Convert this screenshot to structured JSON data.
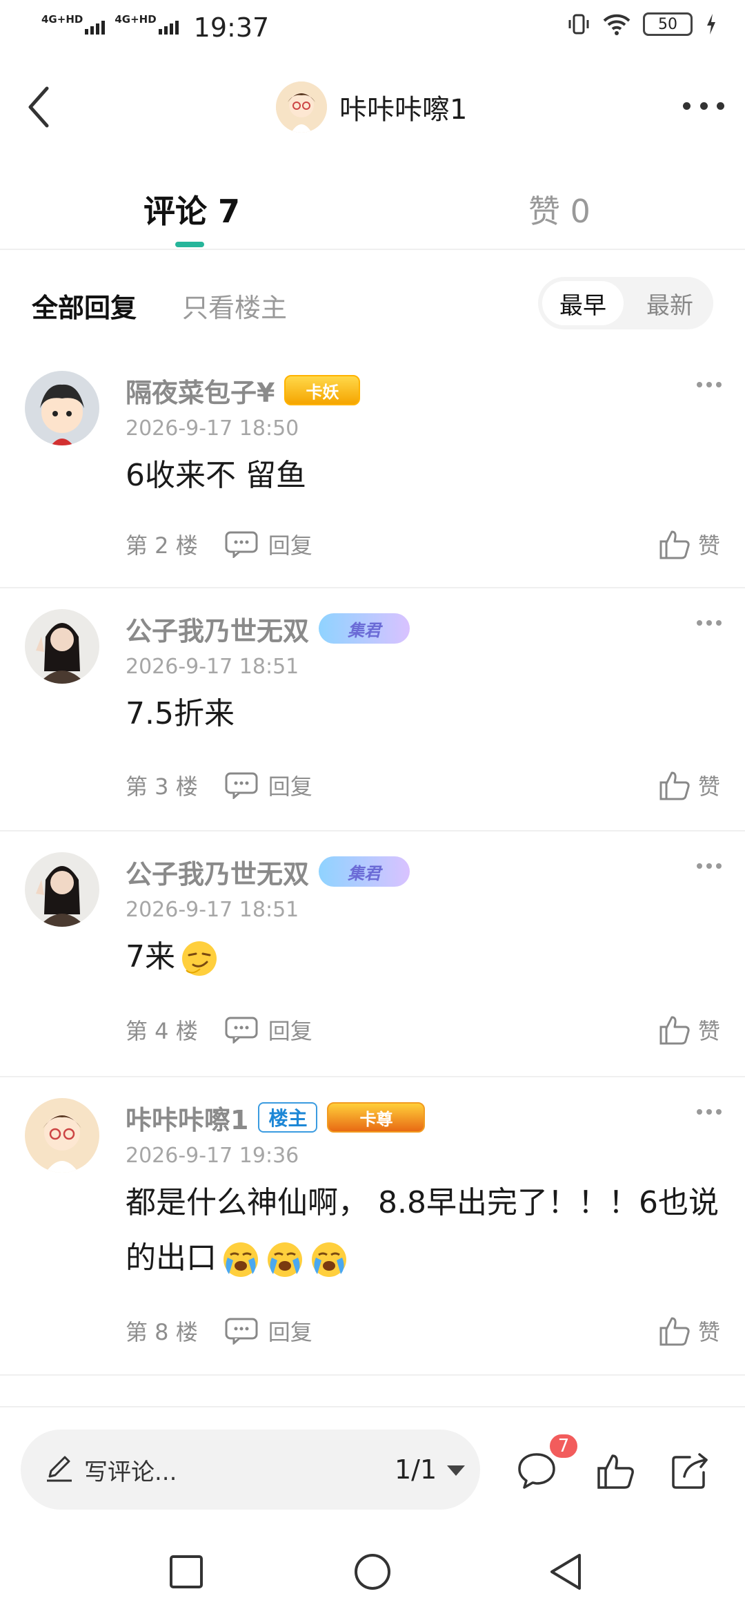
{
  "status_bar": {
    "network_1": "4G+HD",
    "network_2": "4G+HD",
    "time": "19:37",
    "battery": "50"
  },
  "header": {
    "title": "咔咔咔嚓1"
  },
  "tabs": {
    "comments": "评论 7",
    "likes": "赞 0"
  },
  "filter": {
    "all": "全部回复",
    "owner_only": "只看楼主",
    "sort_earliest": "最早",
    "sort_latest": "最新"
  },
  "comments": [
    {
      "username": "隔夜菜包子¥",
      "badge": "卡妖",
      "time": "2026-9-17 18:50",
      "text": "6收来不 留鱼",
      "floor": "第 2 楼",
      "reply": "回复",
      "like": "赞"
    },
    {
      "username": "公子我乃世无双",
      "badge": "集君",
      "time": "2026-9-17 18:51",
      "text": "7.5折来",
      "floor": "第 3 楼",
      "reply": "回复",
      "like": "赞"
    },
    {
      "username": "公子我乃世无双",
      "badge": "集君",
      "time": "2026-9-17 18:51",
      "text": "7来",
      "floor": "第 4 楼",
      "reply": "回复",
      "like": "赞"
    },
    {
      "username": "咔咔咔嚓1",
      "owner_badge": "楼主",
      "badge": "卡尊",
      "time": "2026-9-17 19:36",
      "text": "都是什么神仙啊， 8.8早出完了！！！6也说的出口",
      "floor": "第 8 楼",
      "reply": "回复",
      "like": "赞"
    }
  ],
  "bottom_bar": {
    "write_placeholder": "写评论...",
    "page_indicator": "1/1",
    "comment_count": "7"
  },
  "colors": {
    "accent": "#26b59a",
    "badge_red": "#f25c5c",
    "owner_blue": "#1d87d6"
  },
  "icons": [
    "back-icon",
    "more-icon",
    "reply-icon",
    "like-icon",
    "pen-icon",
    "comment-icon",
    "share-icon",
    "nav-square-icon",
    "nav-circle-icon",
    "nav-back-icon"
  ]
}
